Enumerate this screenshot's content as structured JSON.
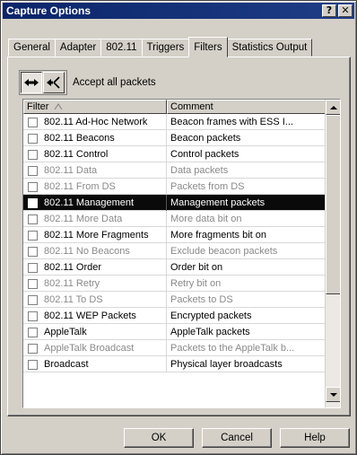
{
  "window": {
    "title": "Capture Options",
    "help_glyph": "?",
    "close_glyph": "✕"
  },
  "tabs": [
    {
      "label": "General"
    },
    {
      "label": "Adapter"
    },
    {
      "label": "802.11"
    },
    {
      "label": "Triggers"
    },
    {
      "label": "Filters",
      "active": true
    },
    {
      "label": "Statistics Output"
    }
  ],
  "toolbar": {
    "accept_label": "Accept all packets",
    "icons": [
      "accept-all-icon",
      "filter-select-icon"
    ]
  },
  "list": {
    "columns": [
      "Filter",
      "Comment"
    ],
    "rows": [
      {
        "filter": "802.11 Ad-Hoc Network",
        "comment": "Beacon frames with ESS I...",
        "dim": false
      },
      {
        "filter": "802.11 Beacons",
        "comment": "Beacon packets",
        "dim": false
      },
      {
        "filter": "802.11 Control",
        "comment": "Control packets",
        "dim": false
      },
      {
        "filter": "802.11 Data",
        "comment": "Data packets",
        "dim": true
      },
      {
        "filter": "802.11 From DS",
        "comment": "Packets from DS",
        "dim": true
      },
      {
        "filter": "802.11 Management",
        "comment": "Management packets",
        "dim": false,
        "selected": true
      },
      {
        "filter": "802.11 More Data",
        "comment": "More data bit on",
        "dim": true
      },
      {
        "filter": "802.11 More Fragments",
        "comment": "More fragments bit on",
        "dim": false
      },
      {
        "filter": "802.11 No Beacons",
        "comment": "Exclude beacon packets",
        "dim": true
      },
      {
        "filter": "802.11 Order",
        "comment": "Order bit on",
        "dim": false
      },
      {
        "filter": "802.11 Retry",
        "comment": "Retry bit on",
        "dim": true
      },
      {
        "filter": "802.11 To DS",
        "comment": "Packets to DS",
        "dim": true
      },
      {
        "filter": "802.11 WEP Packets",
        "comment": "Encrypted packets",
        "dim": false
      },
      {
        "filter": "AppleTalk",
        "comment": "AppleTalk packets",
        "dim": false
      },
      {
        "filter": "AppleTalk Broadcast",
        "comment": "Packets to the AppleTalk b...",
        "dim": true
      },
      {
        "filter": "Broadcast",
        "comment": "Physical layer broadcasts",
        "dim": false
      }
    ]
  },
  "buttons": {
    "ok": "OK",
    "cancel": "Cancel",
    "help": "Help"
  }
}
